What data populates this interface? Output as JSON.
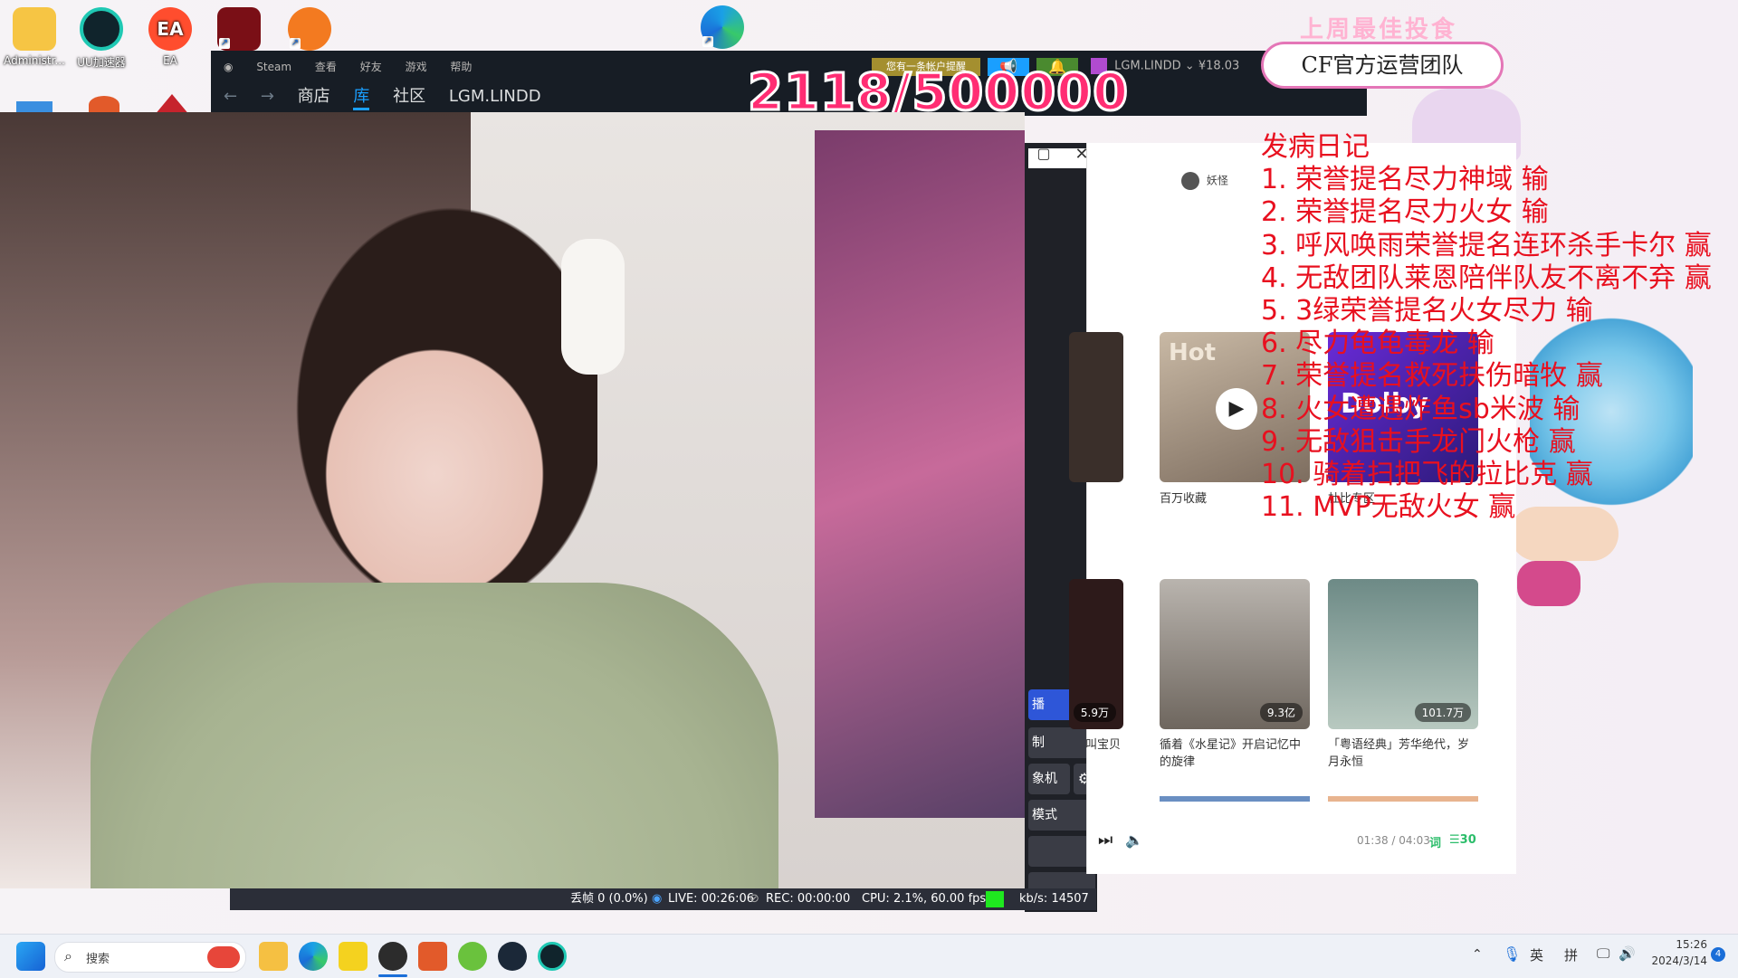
{
  "desktop": {
    "icons": [
      {
        "label": "Administr...",
        "name": "administrator-folder-icon"
      },
      {
        "label": "UU加速器",
        "name": "uu-accelerator-icon"
      },
      {
        "label": "EA",
        "name": "ea-app-icon"
      },
      {
        "label": "",
        "name": "naraka-icon"
      },
      {
        "label": "",
        "name": "orange-app-icon"
      },
      {
        "label": "",
        "name": "edge-browser-icon"
      }
    ]
  },
  "steam": {
    "menu": [
      "Steam",
      "查看",
      "好友",
      "游戏",
      "帮助"
    ],
    "nav": [
      "商店",
      "库",
      "社区",
      "LGM.LINDD"
    ],
    "notice_label": "您有一条帐户提醒",
    "account": "LGM.LINDD",
    "balance": "¥18.03"
  },
  "overlay": {
    "counter": "2118/500000",
    "last_week": "上周最佳投食",
    "cf_team": "CF官方运营团队",
    "record_title": "发病日记",
    "records": [
      "1. 荣誉提名尽力神域  输",
      "2. 荣誉提名尽力火女  输",
      "3. 呼风唤雨荣誉提名连环杀手卡尔  赢",
      "4. 无敌团队莱恩陪伴队友不离不弃  赢",
      "5. 3绿荣誉提名火女尽力  输",
      "6. 尽力龟龟毒龙  输",
      "7. 荣誉提名救死扶伤暗牧  赢",
      "8. 火女遭遇炸鱼sb米波  输",
      "9. 无敌狙击手龙门火枪  赢",
      "10. 骑着扫把飞的拉比克  赢",
      "11. MVP无敌火女  赢"
    ]
  },
  "obs_panel": {
    "buttons": [
      "播",
      "制",
      "象机",
      "模式"
    ]
  },
  "music": {
    "user": "妖怪",
    "cards_row1": [
      {
        "badge": "Hot",
        "caption": "百万收藏"
      },
      {
        "badge": "",
        "caption": "杜比专区"
      }
    ],
    "cards_row2": [
      {
        "plays": "5.9万",
        "caption": "叫宝贝"
      },
      {
        "plays": "9.3亿",
        "caption": "循着《水星记》开启记忆中的旋律"
      },
      {
        "plays": "101.7万",
        "caption": "「粤语经典」芳华绝代，岁月永恒"
      }
    ],
    "time": "01:38 / 04:03",
    "lyric_label": "词",
    "queue_count": "30"
  },
  "obs_status": {
    "dropped": "丢帧 0 (0.0%)",
    "live": "LIVE: 00:26:06",
    "rec": "REC: 00:00:00",
    "cpu": "CPU: 2.1%, 60.00 fps",
    "bitrate": "kb/s: 14507"
  },
  "taskbar": {
    "search_placeholder": "搜索",
    "ime_lang": "英",
    "ime_mode": "拼",
    "time": "15:26",
    "date": "2024/3/14",
    "notif_count": "4"
  },
  "colors": {
    "record_red": "#e8101f",
    "counter_pink": "#ff2d73",
    "steam_bg": "#171d25",
    "steam_blue": "#1a9fff"
  }
}
